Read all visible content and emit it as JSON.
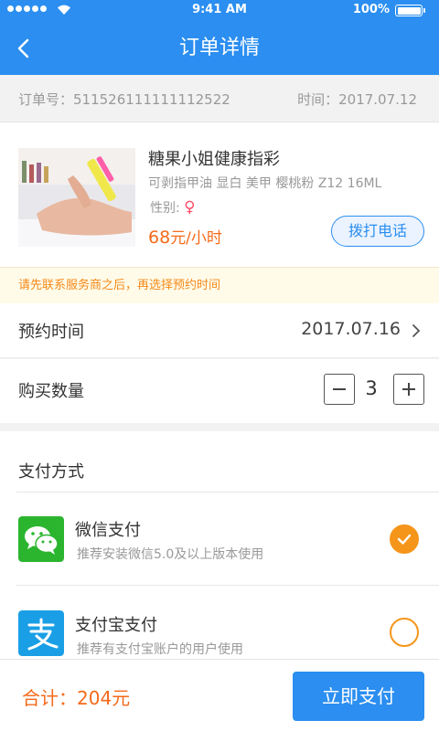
{
  "status_bar": {
    "time": "9:41 AM",
    "battery": "100%"
  },
  "nav": {
    "title": "订单详情"
  },
  "order": {
    "number": "订单号：511526111111112522",
    "time": "时间：2017.07.12"
  },
  "product": {
    "title": "糖果小姐健康指彩",
    "spec": "可剥指甲油 显白 美甲 樱桃粉 Z12 16ML",
    "gender_label": "性别:",
    "gender_symbol": "♀",
    "price_value": "68",
    "price_unit": "元/小时",
    "call_label": "拨打电话"
  },
  "notice": "请先联系服务商之后，再选择预约时间",
  "appointment": {
    "label": "预约时间",
    "value": "2017.07.16"
  },
  "quantity": {
    "label": "购买数量",
    "value": "3"
  },
  "payment": {
    "header": "支付方式",
    "methods": [
      {
        "name": "微信支付",
        "desc": "推荐安装微信5.0及以上版本使用",
        "selected": true
      },
      {
        "name": "支付宝支付",
        "desc": "推荐有支付宝账户的用户使用",
        "selected": false
      }
    ]
  },
  "footer": {
    "total": "合计：204元",
    "pay_label": "立即支付"
  },
  "colors": {
    "primary": "#2b8ef0",
    "accent": "#f56a1a",
    "radio": "#f5951a",
    "wechat": "#2bb52f",
    "alipay": "#1a9fe6"
  }
}
